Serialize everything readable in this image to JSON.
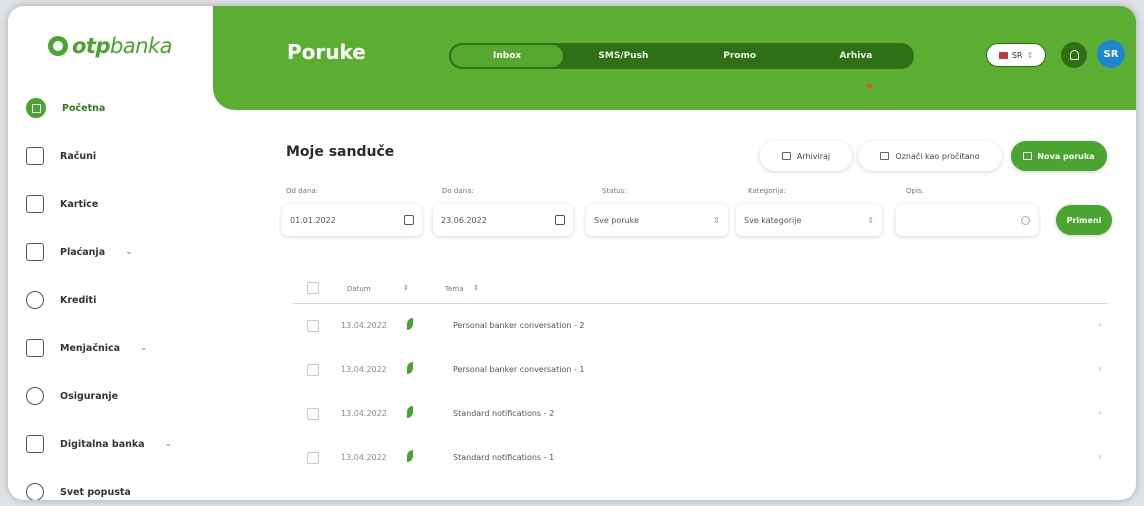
{
  "brand": {
    "name_bold": "otp",
    "name_light": "banka",
    "color": "#4aa52e"
  },
  "sidebar": {
    "items": [
      {
        "label": "Početna",
        "icon": "home-icon",
        "active": true
      },
      {
        "label": "Računi",
        "icon": "accounts-icon"
      },
      {
        "label": "Kartice",
        "icon": "card-icon"
      },
      {
        "label": "Plaćanja",
        "icon": "payments-icon",
        "expandable": true
      },
      {
        "label": "Krediti",
        "icon": "loans-icon"
      },
      {
        "label": "Menjačnica",
        "icon": "exchange-icon",
        "expandable": true
      },
      {
        "label": "Osiguranje",
        "icon": "insurance-icon"
      },
      {
        "label": "Digitalna banka",
        "icon": "digital-bank-icon",
        "expandable": true
      },
      {
        "label": "Svet popusta",
        "icon": "discount-tag-icon"
      }
    ]
  },
  "header": {
    "title": "Poruke",
    "tabs": [
      {
        "label": "Inbox",
        "active": true
      },
      {
        "label": "SMS/Push"
      },
      {
        "label": "Promo"
      },
      {
        "label": "Arhiva"
      }
    ],
    "language": "SR",
    "avatar_initials": "SR",
    "header_color": "#5cae33"
  },
  "main": {
    "title": "Moje sanduče",
    "actions": {
      "archive": "Arhiviraj",
      "mark_read": "Označi kao pročitano",
      "new_message": "Nova poruka"
    },
    "filters": {
      "from_label": "Od dana:",
      "from_value": "01.01.2022",
      "to_label": "Do dana:",
      "to_value": "23.06.2022",
      "status_label": "Status:",
      "status_value": "Sve poruke",
      "category_label": "Kategorija:",
      "category_value": "Sve kategorije",
      "search_label": "Opis:",
      "search_value": "",
      "apply_label": "Primeni"
    },
    "table": {
      "headers": {
        "date": "Datum",
        "subject": "Tema"
      },
      "rows": [
        {
          "date": "13.04.2022",
          "subject": "Personal banker conversation - 2"
        },
        {
          "date": "13.04.2022",
          "subject": "Personal banker conversation - 1"
        },
        {
          "date": "13.04.2022",
          "subject": "Standard notifications - 2"
        },
        {
          "date": "13.04.2022",
          "subject": "Standard notifications - 1"
        }
      ]
    }
  }
}
